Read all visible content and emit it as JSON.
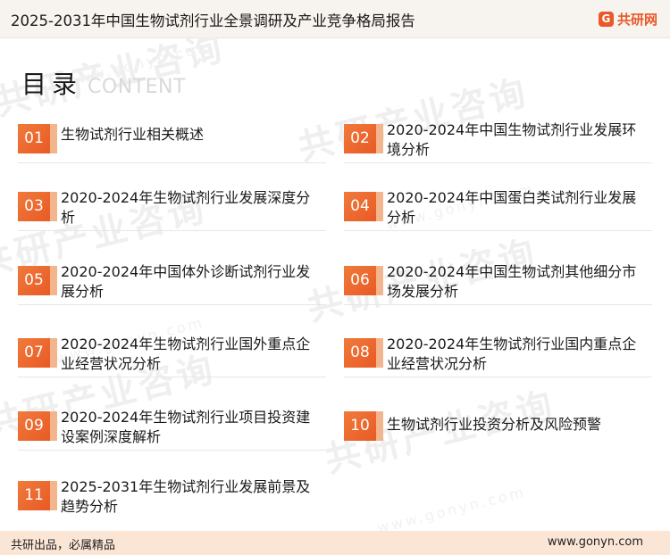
{
  "header": {
    "doc_title": "2025-2031年中国生物试剂行业全景调研及产业竞争格局报告",
    "brand_mark": "G",
    "brand_name": "共研网"
  },
  "watermark": {
    "text": "共研产业咨询",
    "url": "www.gonyn.com"
  },
  "toc": {
    "title": "目录",
    "subtitle": "CONTENT",
    "items": [
      {
        "num": "01",
        "label": "生物试剂行业相关概述"
      },
      {
        "num": "02",
        "label": "2020-2024年中国生物试剂行业发展环境分析"
      },
      {
        "num": "03",
        "label": "2020-2024年生物试剂行业发展深度分析"
      },
      {
        "num": "04",
        "label": "2020-2024年中国蛋白类试剂行业发展分析"
      },
      {
        "num": "05",
        "label": "2020-2024年中国体外诊断试剂行业发展分析"
      },
      {
        "num": "06",
        "label": "2020-2024年中国生物试剂其他细分市场发展分析"
      },
      {
        "num": "07",
        "label": "2020-2024年生物试剂行业国外重点企业经营状况分析"
      },
      {
        "num": "08",
        "label": "2020-2024年生物试剂行业国内重点企业经营状况分析"
      },
      {
        "num": "09",
        "label": "2020-2024年生物试剂行业项目投资建设案例深度解析"
      },
      {
        "num": "10",
        "label": "生物试剂行业投资分析及风险预警"
      },
      {
        "num": "11",
        "label": "2025-2031年生物试剂行业发展前景及趋势分析"
      }
    ]
  },
  "footer": {
    "slogan": "共研出品，必属精品",
    "website": "www.gonyn.com"
  },
  "colors": {
    "accent": "#e8582a",
    "number_box": "#ee6f33",
    "footer_bg": "#fbe6d6",
    "header_bg": "#f7f3ee"
  }
}
